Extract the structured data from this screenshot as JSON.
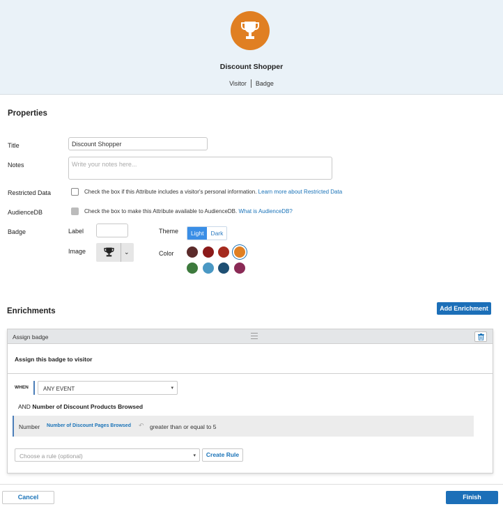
{
  "header": {
    "title": "Discount Shopper",
    "crumb_type": "Visitor",
    "crumb_kind": "Badge",
    "badge_color": "#e07f22",
    "icon": "trophy-icon"
  },
  "properties": {
    "section_title": "Properties",
    "title_label": "Title",
    "title_value": "Discount Shopper",
    "notes_label": "Notes",
    "notes_placeholder": "Write your notes here...",
    "restricted_label": "Restricted Data",
    "restricted_text": "Check the box if this Attribute includes a visitor's personal information.",
    "restricted_link": "Learn more about Restricted Data",
    "audiencedb_label": "AudienceDB",
    "audiencedb_text": "Check the box to make this Attribute available to AudienceDB.",
    "audiencedb_link": "What is AudienceDB?",
    "badge_label": "Badge",
    "badge_sub_label": "Label",
    "badge_label_value": "",
    "image_label": "Image",
    "image_icon": "trophy-icon",
    "theme_label": "Theme",
    "theme_light": "Light",
    "theme_dark": "Dark",
    "theme_selected": "Light",
    "color_label": "Color",
    "colors": [
      "#5b2b2b",
      "#8b1a1a",
      "#a52a1e",
      "#e07f22",
      "#3d7a3d",
      "#4a98c4",
      "#1e4f73",
      "#8a2a56"
    ],
    "color_selected": "#e07f22"
  },
  "enrichments": {
    "section_title": "Enrichments",
    "add_button": "Add Enrichment",
    "card": {
      "title": "Assign badge",
      "action": "Assign this badge to visitor",
      "when_label": "WHEN",
      "when_value": "ANY EVENT",
      "and_label": "AND",
      "and_value": "Number of Discount Products Browsed",
      "rule_type": "Number",
      "rule_field": "Number of Discount Pages Browsed",
      "rule_condition": "greater than or equal to 5",
      "choose_rule_placeholder": "Choose a rule (optional)",
      "create_rule": "Create Rule"
    }
  },
  "footer": {
    "cancel": "Cancel",
    "finish": "Finish"
  }
}
